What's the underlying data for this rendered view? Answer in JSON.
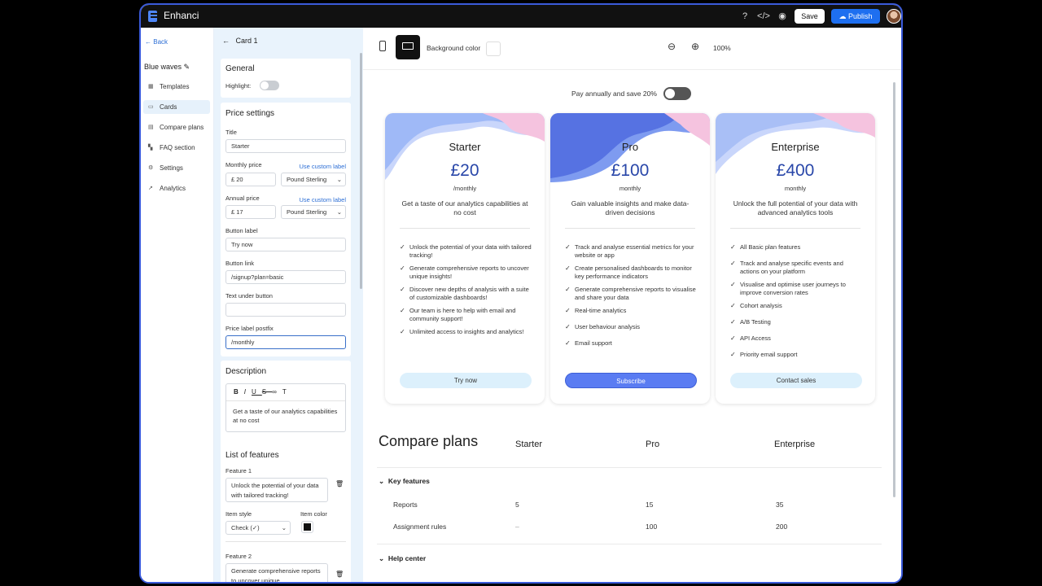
{
  "app": {
    "name": "Enhanci",
    "save": "Save",
    "publish": "Publish"
  },
  "nav": {
    "back": "Back",
    "project": "Blue waves",
    "items": [
      "Templates",
      "Cards",
      "Compare plans",
      "FAQ section",
      "Settings",
      "Analytics"
    ]
  },
  "panel": {
    "title": "Card 1",
    "general": {
      "heading": "General",
      "highlight": "Highlight:"
    },
    "price": {
      "heading": "Price settings",
      "title_label": "Title",
      "title_value": "Starter",
      "monthly_label": "Monthly price",
      "custom": "Use custom label",
      "monthly_value": "£ 20",
      "currency": "Pound Sterling",
      "annual_label": "Annual price",
      "annual_value": "£ 17",
      "button_label": "Button label",
      "button_value": "Try now",
      "link_label": "Button link",
      "link_value": "/signup?plan=basic",
      "under_label": "Text under button",
      "under_value": "",
      "postfix_label": "Price label postfix",
      "postfix_value": "/monthly"
    },
    "description": {
      "heading": "Description",
      "text": "Get a taste of our analytics capabilities at no cost"
    },
    "features": {
      "heading": "List of features",
      "f1_label": "Feature 1",
      "f1_text": "Unlock the potential of your data with tailored tracking!",
      "style_label": "Item style",
      "color_label": "Item color",
      "style_value": "Check (✓)",
      "f2_label": "Feature 2",
      "f2_text": "Generate comprehensive reports to uncover unique"
    }
  },
  "canvas": {
    "bg_label": "Background color",
    "zoom": "100%",
    "annual_toggle": "Pay annually and save 20%",
    "cards": [
      {
        "name": "Starter",
        "price": "£20",
        "per": "/monthly",
        "desc": "Get a taste of our analytics capabilities at no cost",
        "features": [
          "Unlock the potential of your data with tailored tracking!",
          "Generate comprehensive reports to uncover unique insights!",
          "Discover new depths of analysis with a suite of customizable dashboards!",
          "Our team is here to help with email and community support!",
          "Unlimited access to insights and analytics!"
        ],
        "button": "Try now"
      },
      {
        "name": "Pro",
        "price": "£100",
        "per": "monthly",
        "desc": "Gain valuable insights and make data-driven decisions",
        "features": [
          "Track and analyse essential metrics for your website or app",
          "Create personalised dashboards to monitor key performance indicators",
          "Generate comprehensive reports to visualise and share your data",
          "Real-time analytics",
          "User behaviour analysis",
          "Email support"
        ],
        "button": "Subscribe"
      },
      {
        "name": "Enterprise",
        "price": "£400",
        "per": "monthly",
        "desc": "Unlock the full potential of your data with advanced analytics tools",
        "features": [
          "All Basic plan features",
          "Track and analyse specific events and actions on your platform",
          "Visualise and optimise user journeys to improve conversion rates",
          "Cohort analysis",
          "A/B Testing",
          "API Access",
          "Priority email support"
        ],
        "button": "Contact sales"
      }
    ],
    "compare": {
      "title": "Compare plans",
      "cols": [
        "Starter",
        "Pro",
        "Enterprise"
      ],
      "group1": "Key features",
      "rows": [
        {
          "name": "Reports",
          "v": [
            "5",
            "15",
            "35"
          ]
        },
        {
          "name": "Assignment rules",
          "v": [
            "–",
            "100",
            "200"
          ]
        }
      ],
      "group2": "Help center"
    }
  },
  "colors": {
    "accent": "#1e6ff0",
    "price": "#2947a9",
    "subscribe": "#5a7cf2"
  }
}
